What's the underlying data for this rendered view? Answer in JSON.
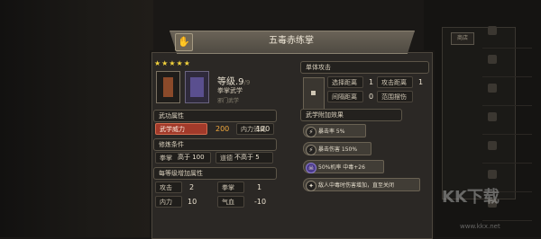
{
  "title": "五毒赤练掌",
  "stars": "★★★★★",
  "level": {
    "label": "等级",
    "value": ".9",
    "max": "/9"
  },
  "weapon_type": "拳掌武学",
  "school": "邪门武学",
  "sections": {
    "attributes": "武功属性",
    "requirements": "修炼条件",
    "per_level": "每等级增加属性",
    "attack": "单体攻击",
    "effects": "武学附加效果"
  },
  "attributes": [
    {
      "label": "武学威力",
      "value": "200",
      "highlight": true
    },
    {
      "label": "内力消耗",
      "value": "120"
    }
  ],
  "requirements": [
    {
      "label": "拳掌",
      "value": "高于 100"
    },
    {
      "label": "道德",
      "value": "不高于 5"
    }
  ],
  "per_level": [
    {
      "label": "攻击",
      "value": "2"
    },
    {
      "label": "拳掌",
      "value": "1"
    },
    {
      "label": "内力",
      "value": "10"
    },
    {
      "label": "气血",
      "value": "-10"
    }
  ],
  "attack": [
    {
      "label": "选择距离",
      "value": "1"
    },
    {
      "label": "攻击距离",
      "value": "1"
    },
    {
      "label": "间隔距离",
      "value": "0"
    },
    {
      "label": "范围摆伤",
      "value": ""
    }
  ],
  "effects": [
    {
      "icon": "⚡",
      "text": "暴击率  5%"
    },
    {
      "icon": "⚡",
      "text": "暴击伤害  150%"
    },
    {
      "icon": "☠",
      "text": "50%机率  中毒+26"
    },
    {
      "icon": "✦",
      "text": "敌人中毒时伤害增加，直至关闭"
    }
  ],
  "watermark": "KK下载",
  "watermark_url": "www.kkx.net",
  "right_tab": "商店"
}
